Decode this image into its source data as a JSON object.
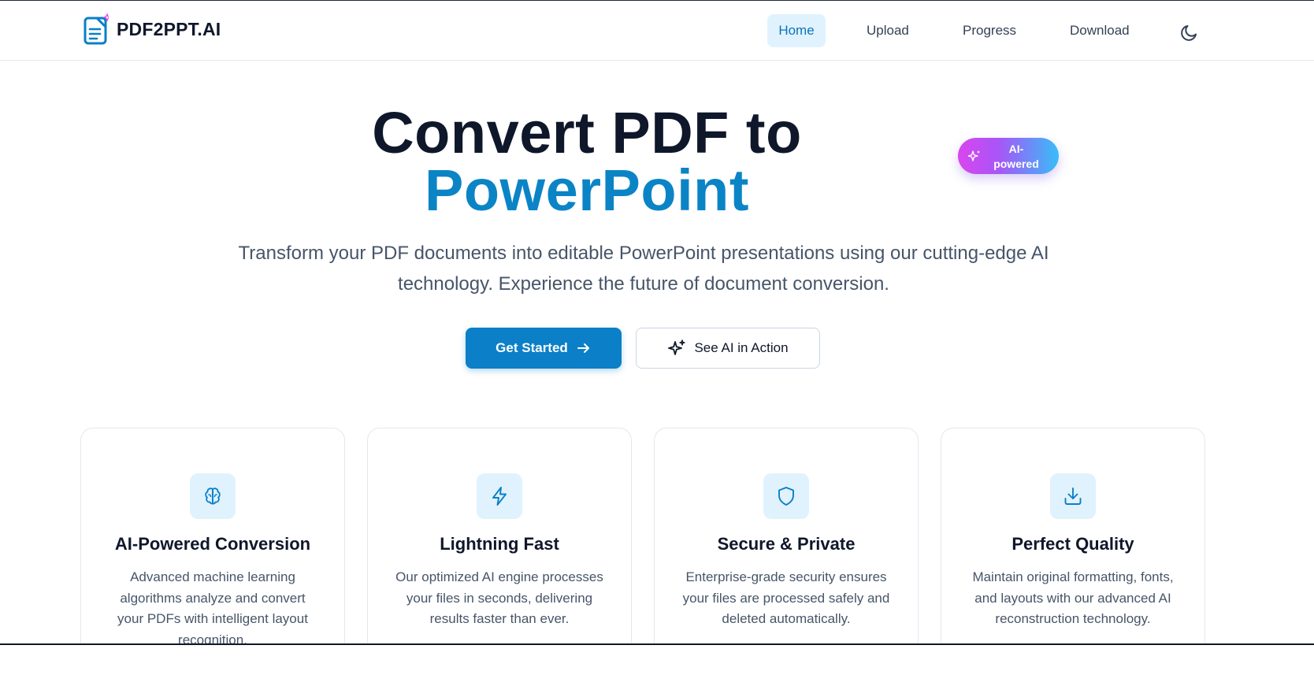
{
  "app": {
    "brand": "PDF2PPT.AI"
  },
  "nav": {
    "items": [
      {
        "label": "Home",
        "active": true
      },
      {
        "label": "Upload",
        "active": false
      },
      {
        "label": "Progress",
        "active": false
      },
      {
        "label": "Download",
        "active": false
      }
    ],
    "theme_toggle_icon": "moon-icon"
  },
  "hero": {
    "title_line1": "Convert PDF to",
    "title_line2": "PowerPoint",
    "badge": "AI-powered",
    "subtitle": "Transform your PDF documents into editable PowerPoint presentations using our cutting-edge AI technology. Experience the future of document conversion.",
    "primary_button": "Get Started",
    "secondary_button": "See AI in Action"
  },
  "features": [
    {
      "icon": "brain-icon",
      "title": "AI-Powered Conversion",
      "description": "Advanced machine learning algorithms analyze and convert your PDFs with intelligent layout recognition."
    },
    {
      "icon": "lightning-icon",
      "title": "Lightning Fast",
      "description": "Our optimized AI engine processes your files in seconds, delivering results faster than ever."
    },
    {
      "icon": "shield-icon",
      "title": "Secure & Private",
      "description": "Enterprise-grade security ensures your files are processed safely and deleted automatically."
    },
    {
      "icon": "download-icon",
      "title": "Perfect Quality",
      "description": "Maintain original formatting, fonts, and layouts with our advanced AI reconstruction technology."
    }
  ],
  "colors": {
    "primary": "#0b7fc7",
    "title_accent": "#0b84c6",
    "nav_active_bg": "#e0f2fe",
    "badge_gradient": [
      "#d946ef",
      "#38bdf8"
    ]
  }
}
